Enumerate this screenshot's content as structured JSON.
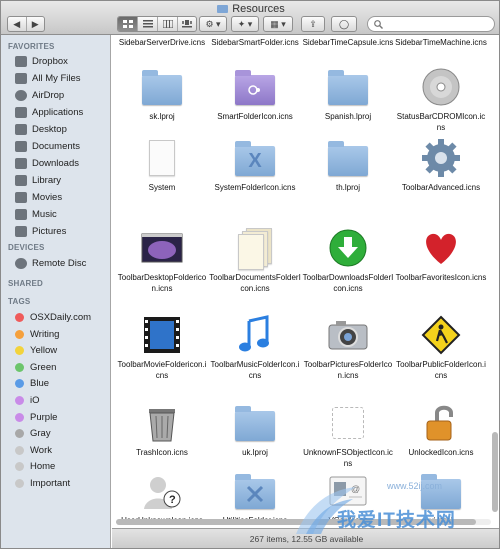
{
  "window": {
    "title": "Resources"
  },
  "toolbar": {
    "back": "◀",
    "forward": "▶",
    "view_icon": "icon-view-icon",
    "view_list": "list-view-icon",
    "view_column": "column-view-icon",
    "view_coverflow": "coverflow-view-icon",
    "action": "⚙ ▾",
    "dropbox": "✦ ▾",
    "arrange": "▦ ▾",
    "share": "⇪",
    "tags": "◯",
    "search_placeholder": ""
  },
  "sidebar": {
    "favorites_header": "FAVORITES",
    "favorites": [
      {
        "label": "Dropbox",
        "icon": "dropbox-icon"
      },
      {
        "label": "All My Files",
        "icon": "all-files-icon"
      },
      {
        "label": "AirDrop",
        "icon": "airdrop-icon"
      },
      {
        "label": "Applications",
        "icon": "applications-icon"
      },
      {
        "label": "Desktop",
        "icon": "desktop-icon"
      },
      {
        "label": "Documents",
        "icon": "documents-icon"
      },
      {
        "label": "Downloads",
        "icon": "downloads-icon"
      },
      {
        "label": "Library",
        "icon": "library-icon"
      },
      {
        "label": "Movies",
        "icon": "movies-icon"
      },
      {
        "label": "Music",
        "icon": "music-icon"
      },
      {
        "label": "Pictures",
        "icon": "pictures-icon"
      }
    ],
    "devices_header": "DEVICES",
    "devices": [
      {
        "label": "Remote Disc",
        "icon": "remote-disc-icon"
      }
    ],
    "shared_header": "SHARED",
    "tags_header": "TAGS",
    "tags": [
      {
        "label": "OSXDaily.com",
        "color": "#ef5b5b"
      },
      {
        "label": "Writing",
        "color": "#f5a03c"
      },
      {
        "label": "Yellow",
        "color": "#f2d33c"
      },
      {
        "label": "Green",
        "color": "#6cc56c"
      },
      {
        "label": "Blue",
        "color": "#5a9be6"
      },
      {
        "label": "iO",
        "color": "#c98be8"
      },
      {
        "label": "Purple",
        "color": "#c98be8"
      },
      {
        "label": "Gray",
        "color": "#a8a8a8"
      },
      {
        "label": "Work",
        "color": "#c8c8c8"
      },
      {
        "label": "Home",
        "color": "#c8c8c8"
      },
      {
        "label": "Important",
        "color": "#c8c8c8"
      }
    ]
  },
  "files": {
    "row0": [
      "SidebarServerDrive.icns",
      "SidebarSmartFolder.icns",
      "SidebarTimeCapsule.icns",
      "SidebarTimeMachine.icns"
    ],
    "items": [
      {
        "name": "sk.lproj",
        "icon": "folder-icon"
      },
      {
        "name": "SmartFolderIcon.icns",
        "icon": "smart-folder-icon"
      },
      {
        "name": "Spanish.lproj",
        "icon": "folder-icon"
      },
      {
        "name": "StatusBarCDROMIcon.icns",
        "icon": "cd-rom-icon"
      },
      {
        "name": "System",
        "icon": "document-icon"
      },
      {
        "name": "SystemFolderIcon.icns",
        "icon": "system-folder-icon"
      },
      {
        "name": "th.lproj",
        "icon": "folder-icon"
      },
      {
        "name": "ToolbarAdvanced.icns",
        "icon": "gear-icon"
      },
      {
        "name": "ToolbarDesktopFoldericon.icns",
        "icon": "desktop-picture-icon"
      },
      {
        "name": "ToolbarDocumentsFolderIcon.icns",
        "icon": "documents-stack-icon"
      },
      {
        "name": "ToolbarDownloadsFolderIcon.icns",
        "icon": "downloads-arrow-icon"
      },
      {
        "name": "ToolbarFavoritesIcon.icns",
        "icon": "heart-icon"
      },
      {
        "name": "ToolbarMovieFoldericon.icns",
        "icon": "film-strip-icon"
      },
      {
        "name": "ToolbarMusicFolderIcon.icns",
        "icon": "music-note-icon"
      },
      {
        "name": "ToolbarPicturesFolderIcon.icns",
        "icon": "camera-icon"
      },
      {
        "name": "ToolbarPublicFolderIcon.icns",
        "icon": "pedestrian-sign-icon"
      },
      {
        "name": "TrashIcon.icns",
        "icon": "trash-icon"
      },
      {
        "name": "uk.lproj",
        "icon": "folder-icon"
      },
      {
        "name": "UnknownFSObjectIcon.icns",
        "icon": "unknown-object-icon"
      },
      {
        "name": "UnlockedIcon.icns",
        "icon": "padlock-icon"
      },
      {
        "name": "UserUnknownIcon.icns",
        "icon": "unknown-user-icon"
      },
      {
        "name": "UtilitiesFolder.icns",
        "icon": "utilities-folder-icon"
      },
      {
        "name": "VCard.icns",
        "icon": "vcard-icon"
      },
      {
        "name": "vi.lproj",
        "icon": "folder-icon"
      }
    ]
  },
  "status": {
    "text": "267 items, 12.55 GB available"
  },
  "watermark": {
    "text": "我爱IT技术网",
    "url": "www.52ij.com"
  },
  "colors": {
    "folder": "#8db3dd",
    "sidebar": "#dde4ec",
    "accent": "#4a8fd6"
  }
}
